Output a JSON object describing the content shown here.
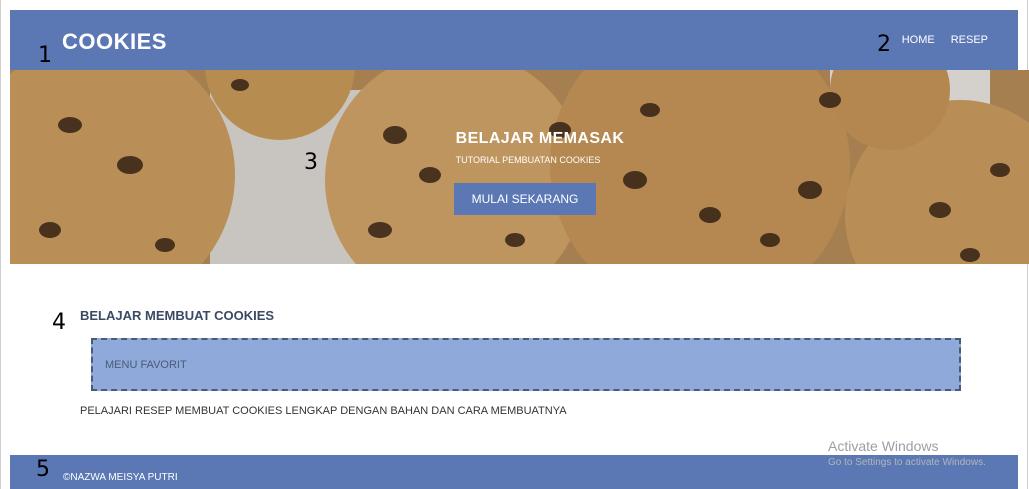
{
  "header": {
    "logo": "COOKIES",
    "nav": [
      "HOME",
      "RESEP"
    ]
  },
  "hero": {
    "title": "BELAJAR MEMASAK",
    "subtitle": "TUTORIAL PEMBUATAN COOKIES",
    "button": "MULAI SEKARANG"
  },
  "content": {
    "section_title": "BELAJAR MEMBUAT COOKIES",
    "menu_label": "MENU FAVORIT",
    "description": "PELAJARI RESEP MEMBUAT COOKIES LENGKAP DENGAN BAHAN DAN CARA MEMBUATNYA"
  },
  "footer": {
    "copyright": "©NAZWA MEISYA PUTRI"
  },
  "watermark": {
    "title": "Activate Windows",
    "subtitle": "Go to Settings to activate Windows."
  },
  "annotations": [
    "1",
    "2",
    "3",
    "4",
    "5"
  ],
  "colors": {
    "primary": "#5b78b4",
    "menu_box": "#8ea9da"
  }
}
